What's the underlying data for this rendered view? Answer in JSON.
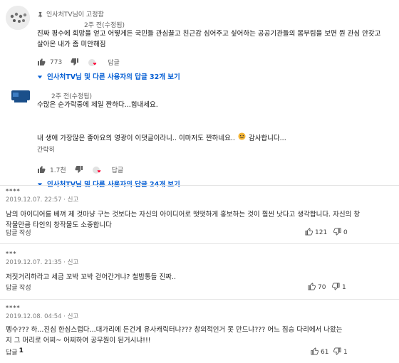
{
  "comments_top": [
    {
      "pinned_label": "인사처TV님이 고정함",
      "time": "2주 전(수정됨)",
      "text_lines": [
        "진짜 평수에 회망을 얻고 어떻게든 국민들 관심끌고 친근감 심어주고 싶어하는 공공기관들의 몸부림을 보면 뭔 관심 안갖고",
        "살아온 내가 좀 미안해짐"
      ],
      "likes": "773",
      "reply_label": "답글",
      "view_replies": "인사처TV님 및 다른 사용자의 답글 32개 보기"
    },
    {
      "time": "2주 전(수정됨)",
      "text_lines": [
        "수많은 순가락중에 제일 짠하다...힘내세요."
      ],
      "creator_lines": [
        "내 생애 가장많은 좋아요의 영광이 이댓글이라니..  이마저도 짠하네요..",
        "감사합니다...",
        "간략히"
      ],
      "likes": "1.7천",
      "reply_label": "답글",
      "view_replies": "인사처TV님 및 다른 사용자의 답글 24개 보기"
    }
  ],
  "comments_bottom": [
    {
      "id": "****",
      "meta": "2019.12.07. 22:57 · 신고",
      "text_lines": [
        "남의 아이디어를 베껴 제 것마냥 구는 것보다는 자신의 아이디어로 떳떳하게 홍보하는 것이 훨씬 낫다고 생각합니다. 자신의 창",
        "작물만큼 타인의 창작물도 소중합니다"
      ],
      "reply_label": "답글 작성",
      "up": "121",
      "down": "0"
    },
    {
      "id": "***",
      "meta": "2019.12.07. 21:35 · 신고",
      "text_lines": [
        "저짓거리하라고 세금 꼬박 꼬박 걷어간거냐? 철밥통들 진짜.."
      ],
      "reply_label": "답글 작성",
      "up": "70",
      "down": "1"
    },
    {
      "id": "****",
      "meta": "2019.12.08. 04:54 · 신고",
      "text_lines": [
        "펭수??? 하...진심 한심스럽다...대가리에 든건게 유사캐릭터냐??? 창의적인거 못 만드냐??? 어느 짐승 다리에서 나왔는",
        "지 그 머리로 어찌~ 어찌하여 공무원이 된거시냐!!!"
      ],
      "reply_label": "답글",
      "reply_count": "1",
      "up": "61",
      "down": "1"
    }
  ],
  "colors": {
    "link": "#065fd4",
    "heart": "#ff0033",
    "emoji": "#f2b233"
  }
}
